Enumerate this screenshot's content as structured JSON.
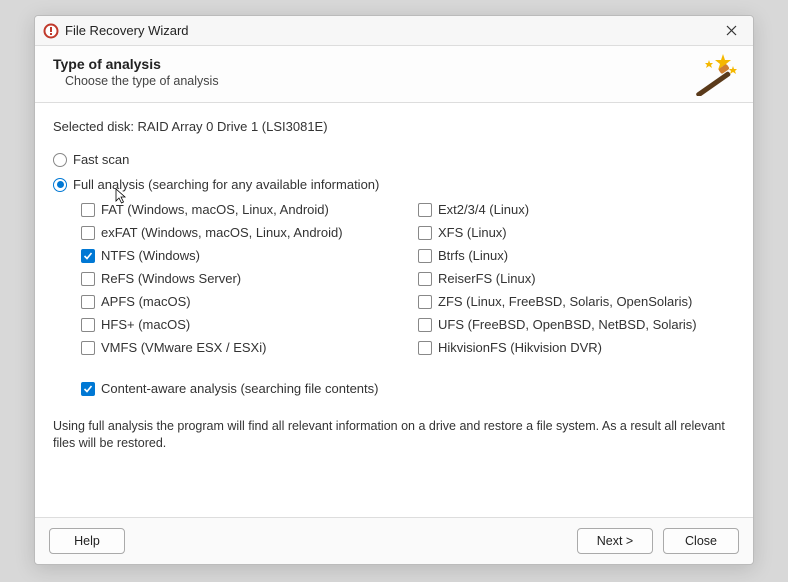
{
  "window": {
    "title": "File Recovery Wizard"
  },
  "header": {
    "title": "Type of analysis",
    "subtitle": "Choose the type of analysis"
  },
  "selectedDiskLabel": "Selected disk: RAID Array 0 Drive 1 (LSI3081E)",
  "scan": {
    "fast": {
      "label": "Fast scan",
      "selected": false
    },
    "full": {
      "label": "Full analysis (searching for any available information)",
      "selected": true
    }
  },
  "filesystems": {
    "left": [
      {
        "name": "fat",
        "label": "FAT (Windows, macOS, Linux, Android)",
        "checked": false
      },
      {
        "name": "exfat",
        "label": "exFAT (Windows, macOS, Linux, Android)",
        "checked": false
      },
      {
        "name": "ntfs",
        "label": "NTFS (Windows)",
        "checked": true
      },
      {
        "name": "refs",
        "label": "ReFS (Windows Server)",
        "checked": false
      },
      {
        "name": "apfs",
        "label": "APFS (macOS)",
        "checked": false
      },
      {
        "name": "hfsplus",
        "label": "HFS+ (macOS)",
        "checked": false
      },
      {
        "name": "vmfs",
        "label": "VMFS (VMware ESX / ESXi)",
        "checked": false
      }
    ],
    "right": [
      {
        "name": "ext",
        "label": "Ext2/3/4 (Linux)",
        "checked": false
      },
      {
        "name": "xfs",
        "label": "XFS (Linux)",
        "checked": false
      },
      {
        "name": "btrfs",
        "label": "Btrfs (Linux)",
        "checked": false
      },
      {
        "name": "reiserfs",
        "label": "ReiserFS (Linux)",
        "checked": false
      },
      {
        "name": "zfs",
        "label": "ZFS (Linux, FreeBSD, Solaris, OpenSolaris)",
        "checked": false
      },
      {
        "name": "ufs",
        "label": "UFS (FreeBSD, OpenBSD, NetBSD, Solaris)",
        "checked": false
      },
      {
        "name": "hikvision",
        "label": "HikvisionFS (Hikvision DVR)",
        "checked": false
      }
    ]
  },
  "contentAware": {
    "label": "Content-aware analysis (searching file contents)",
    "checked": true
  },
  "description": "Using full analysis the program will find all relevant information on a drive and restore a file system. As a result all relevant files will be restored.",
  "buttons": {
    "help": "Help",
    "next": "Next >",
    "close": "Close"
  }
}
